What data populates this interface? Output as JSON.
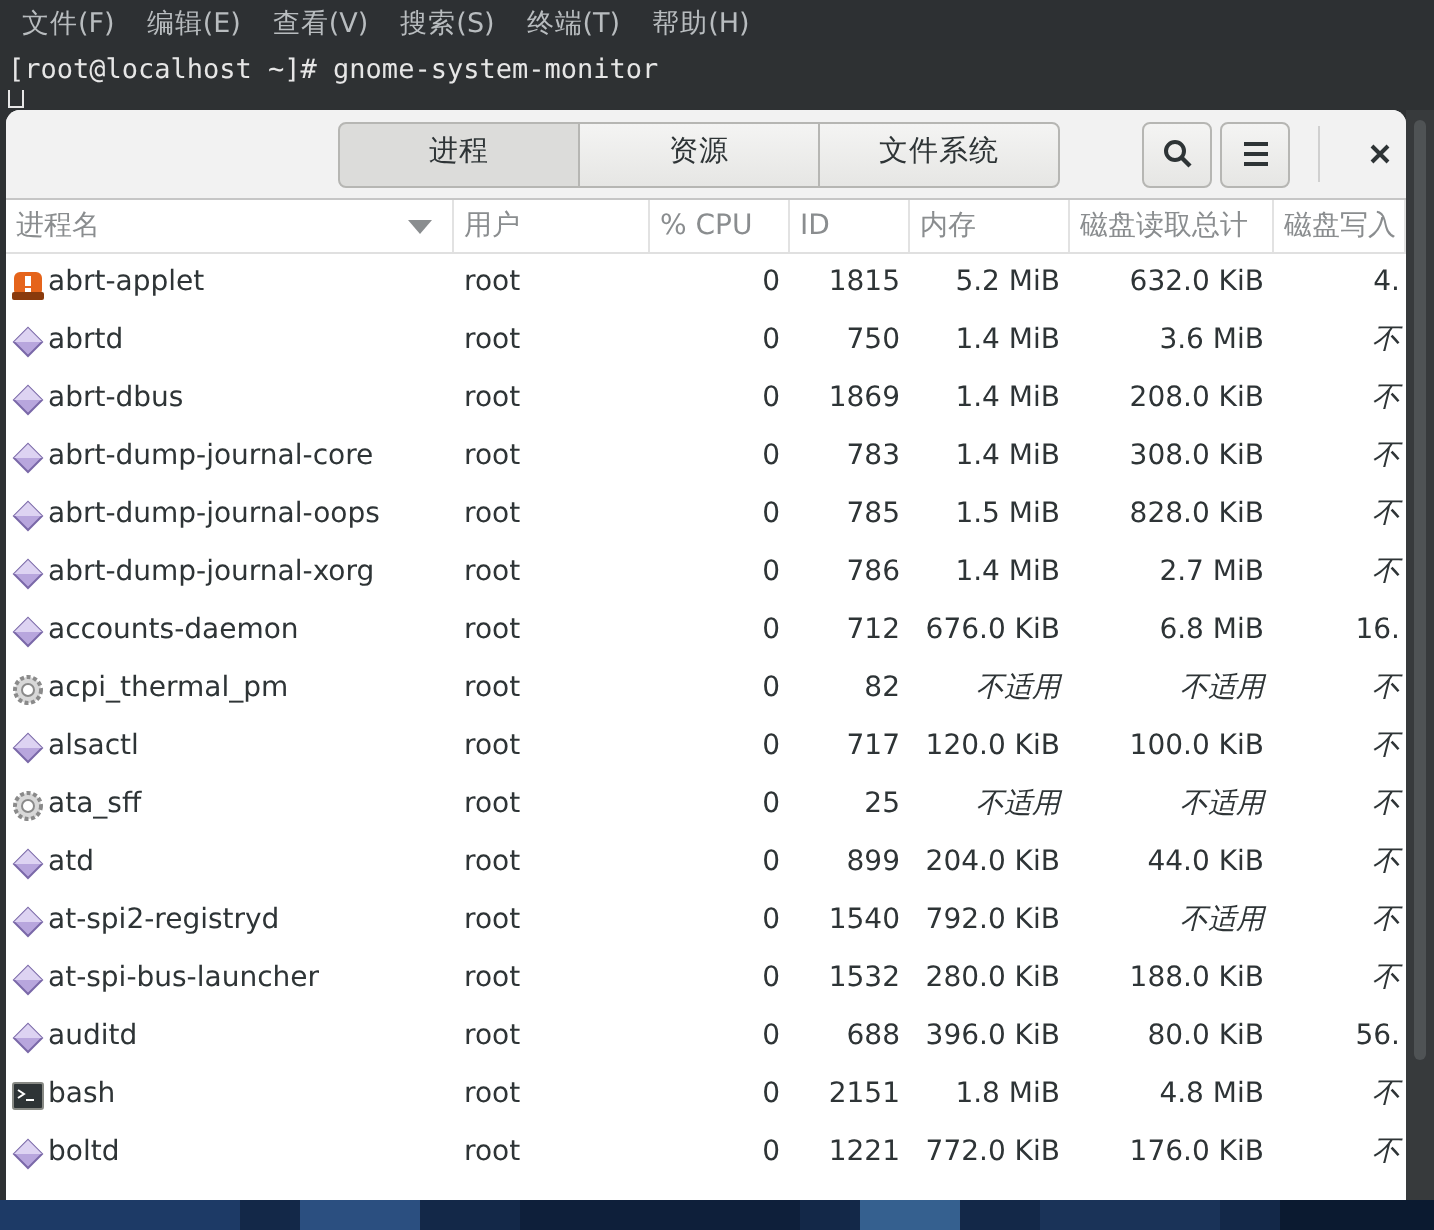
{
  "terminal": {
    "menu": [
      "文件(F)",
      "编辑(E)",
      "查看(V)",
      "搜索(S)",
      "终端(T)",
      "帮助(H)"
    ],
    "prompt": "[root@localhost ~]# gnome-system-monitor"
  },
  "window": {
    "tabs": [
      {
        "label": "进程",
        "selected": true
      },
      {
        "label": "资源",
        "selected": false
      },
      {
        "label": "文件系统",
        "selected": false
      }
    ],
    "buttons": [
      {
        "kind": "search"
      },
      {
        "kind": "menu"
      },
      {
        "kind": "close"
      }
    ]
  },
  "table": {
    "columns": [
      {
        "label": "进程名",
        "sorted": true
      },
      {
        "label": "用户",
        "sorted": false
      },
      {
        "label": "% CPU",
        "sorted": false
      },
      {
        "label": "ID",
        "sorted": false
      },
      {
        "label": "内存",
        "sorted": false
      },
      {
        "label": "磁盘读取总计",
        "sorted": false
      },
      {
        "label": "磁盘写入",
        "sorted": false
      }
    ],
    "rows": [
      {
        "kind": "alert",
        "name": "abrt-applet",
        "user": "root",
        "cpu": "0",
        "id": "1815",
        "memory": "5.2 MiB",
        "memory_na": false,
        "disk_read": "632.0 KiB",
        "read_na": false,
        "disk_write": "4.",
        "write_na": false
      },
      {
        "kind": "diamond",
        "name": "abrtd",
        "user": "root",
        "cpu": "0",
        "id": "750",
        "memory": "1.4 MiB",
        "memory_na": false,
        "disk_read": "3.6 MiB",
        "read_na": false,
        "disk_write": "不",
        "write_na": true
      },
      {
        "kind": "diamond",
        "name": "abrt-dbus",
        "user": "root",
        "cpu": "0",
        "id": "1869",
        "memory": "1.4 MiB",
        "memory_na": false,
        "disk_read": "208.0 KiB",
        "read_na": false,
        "disk_write": "不",
        "write_na": true
      },
      {
        "kind": "diamond",
        "name": "abrt-dump-journal-core",
        "user": "root",
        "cpu": "0",
        "id": "783",
        "memory": "1.4 MiB",
        "memory_na": false,
        "disk_read": "308.0 KiB",
        "read_na": false,
        "disk_write": "不",
        "write_na": true
      },
      {
        "kind": "diamond",
        "name": "abrt-dump-journal-oops",
        "user": "root",
        "cpu": "0",
        "id": "785",
        "memory": "1.5 MiB",
        "memory_na": false,
        "disk_read": "828.0 KiB",
        "read_na": false,
        "disk_write": "不",
        "write_na": true
      },
      {
        "kind": "diamond",
        "name": "abrt-dump-journal-xorg",
        "user": "root",
        "cpu": "0",
        "id": "786",
        "memory": "1.4 MiB",
        "memory_na": false,
        "disk_read": "2.7 MiB",
        "read_na": false,
        "disk_write": "不",
        "write_na": true
      },
      {
        "kind": "diamond",
        "name": "accounts-daemon",
        "user": "root",
        "cpu": "0",
        "id": "712",
        "memory": "676.0 KiB",
        "memory_na": false,
        "disk_read": "6.8 MiB",
        "read_na": false,
        "disk_write": "16.",
        "write_na": false
      },
      {
        "kind": "gear",
        "name": "acpi_thermal_pm",
        "user": "root",
        "cpu": "0",
        "id": "82",
        "memory": "不适用",
        "memory_na": true,
        "disk_read": "不适用",
        "read_na": true,
        "disk_write": "不",
        "write_na": true
      },
      {
        "kind": "diamond",
        "name": "alsactl",
        "user": "root",
        "cpu": "0",
        "id": "717",
        "memory": "120.0 KiB",
        "memory_na": false,
        "disk_read": "100.0 KiB",
        "read_na": false,
        "disk_write": "不",
        "write_na": true
      },
      {
        "kind": "gear",
        "name": "ata_sff",
        "user": "root",
        "cpu": "0",
        "id": "25",
        "memory": "不适用",
        "memory_na": true,
        "disk_read": "不适用",
        "read_na": true,
        "disk_write": "不",
        "write_na": true
      },
      {
        "kind": "diamond",
        "name": "atd",
        "user": "root",
        "cpu": "0",
        "id": "899",
        "memory": "204.0 KiB",
        "memory_na": false,
        "disk_read": "44.0 KiB",
        "read_na": false,
        "disk_write": "不",
        "write_na": true
      },
      {
        "kind": "diamond",
        "name": "at-spi2-registryd",
        "user": "root",
        "cpu": "0",
        "id": "1540",
        "memory": "792.0 KiB",
        "memory_na": false,
        "disk_read": "不适用",
        "read_na": true,
        "disk_write": "不",
        "write_na": true
      },
      {
        "kind": "diamond",
        "name": "at-spi-bus-launcher",
        "user": "root",
        "cpu": "0",
        "id": "1532",
        "memory": "280.0 KiB",
        "memory_na": false,
        "disk_read": "188.0 KiB",
        "read_na": false,
        "disk_write": "不",
        "write_na": true
      },
      {
        "kind": "diamond",
        "name": "auditd",
        "user": "root",
        "cpu": "0",
        "id": "688",
        "memory": "396.0 KiB",
        "memory_na": false,
        "disk_read": "80.0 KiB",
        "read_na": false,
        "disk_write": "56.",
        "write_na": false
      },
      {
        "kind": "terminal",
        "name": "bash",
        "user": "root",
        "cpu": "0",
        "id": "2151",
        "memory": "1.8 MiB",
        "memory_na": false,
        "disk_read": "4.8 MiB",
        "read_na": false,
        "disk_write": "不",
        "write_na": true
      },
      {
        "kind": "diamond",
        "name": "boltd",
        "user": "root",
        "cpu": "0",
        "id": "1221",
        "memory": "772.0 KiB",
        "memory_na": false,
        "disk_read": "176.0 KiB",
        "read_na": false,
        "disk_write": "不",
        "write_na": true
      }
    ]
  }
}
